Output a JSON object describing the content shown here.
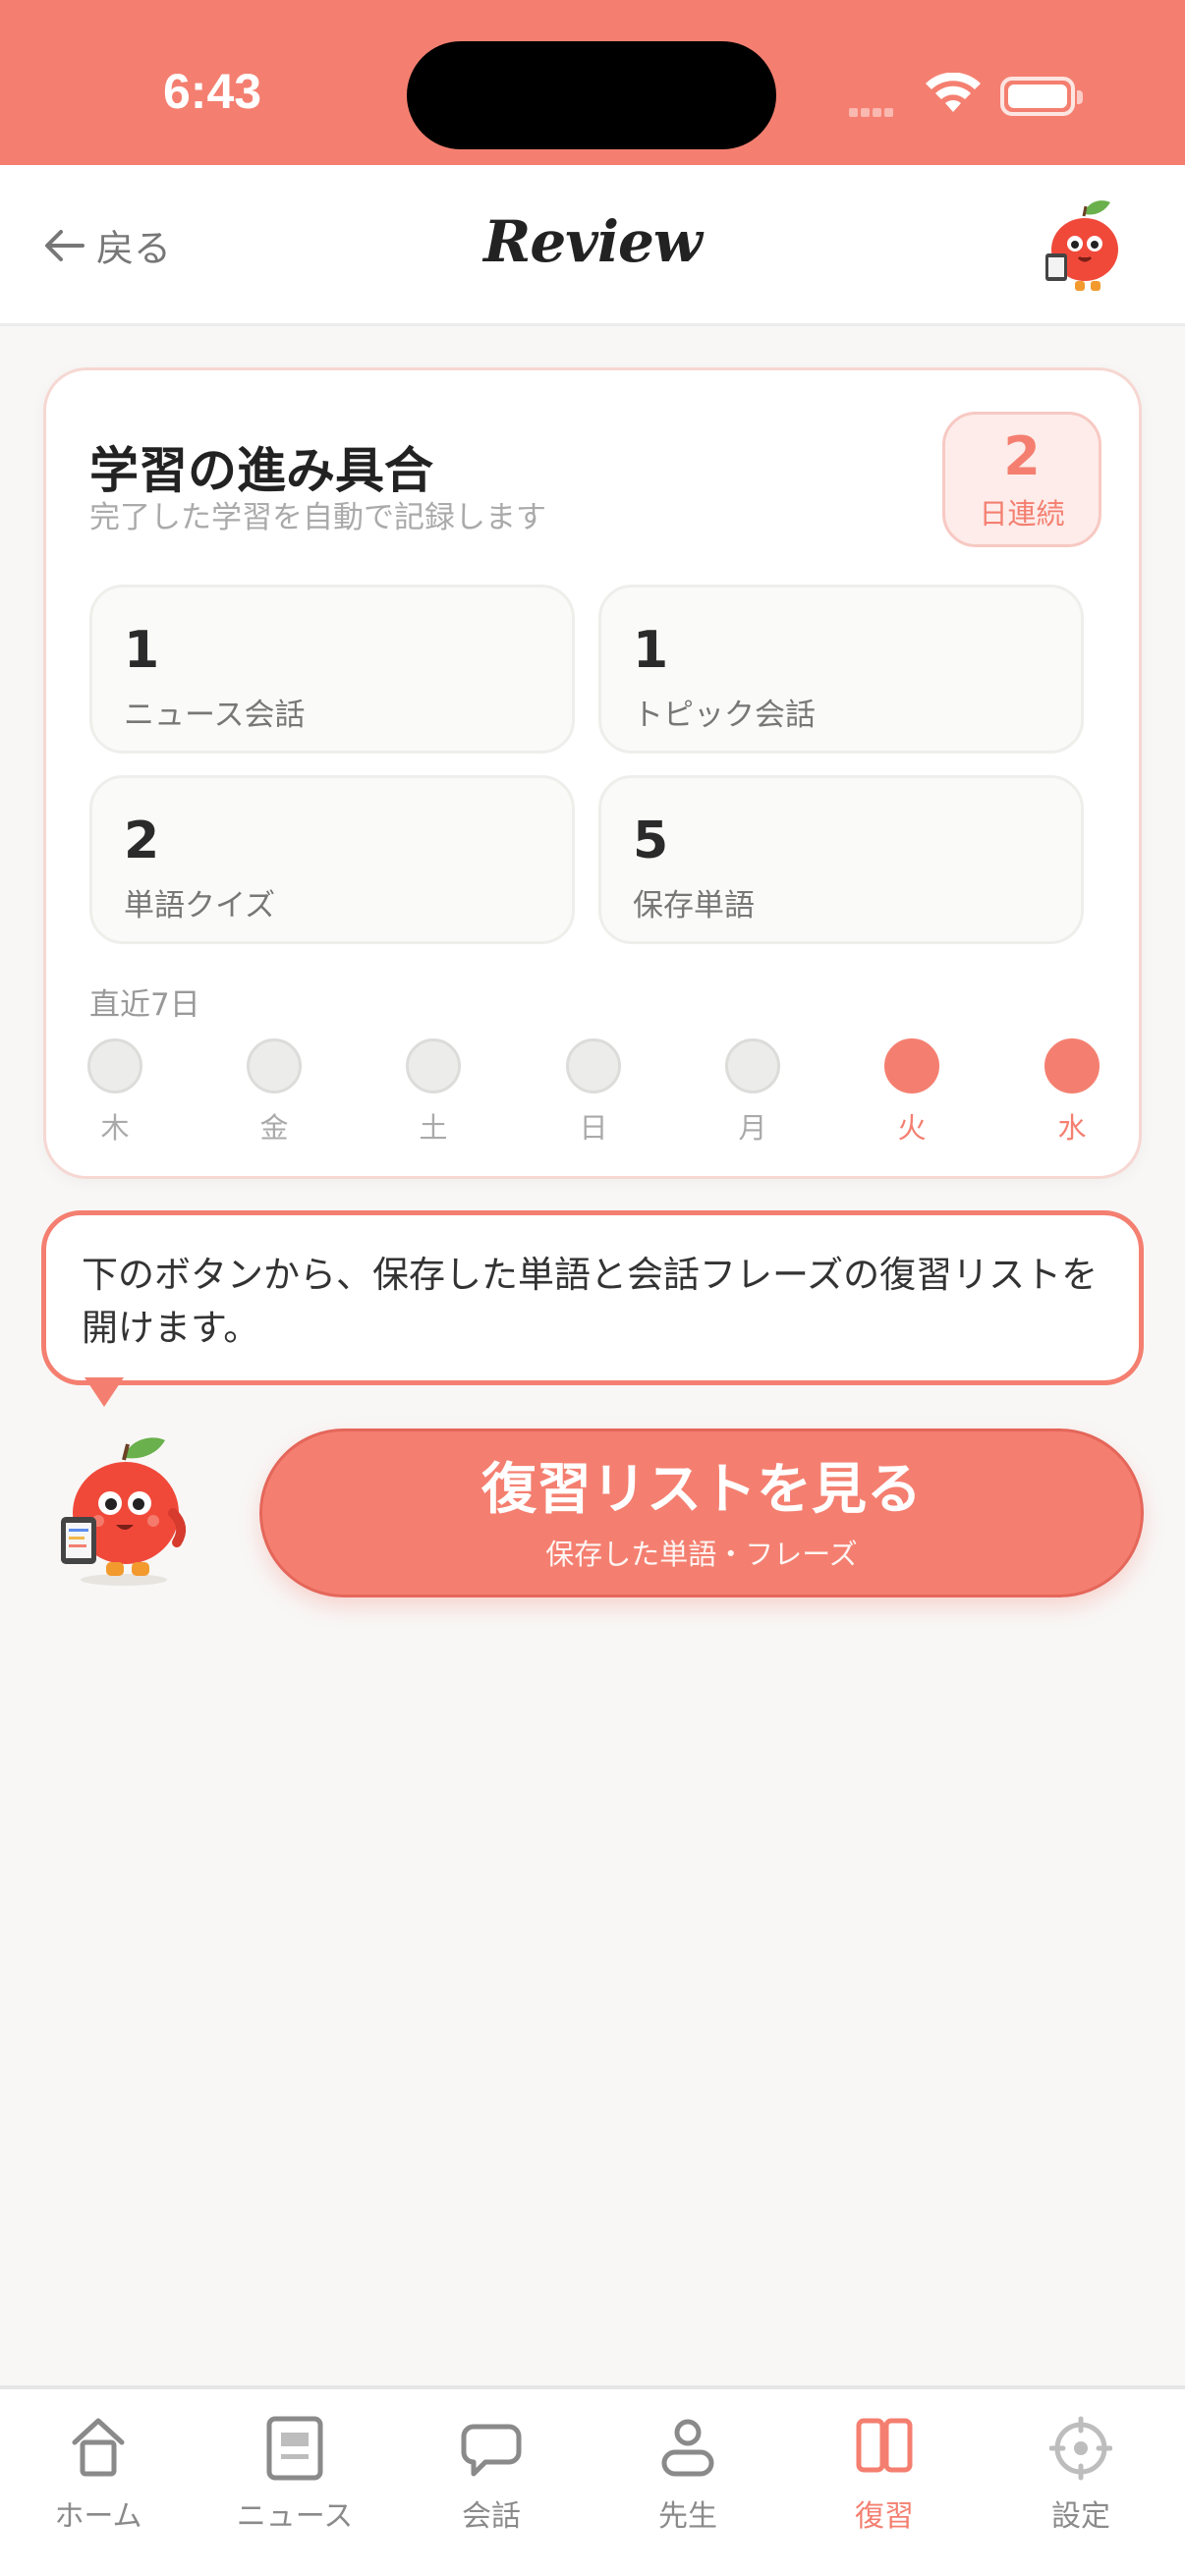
{
  "status_bar": {
    "time": "6:43"
  },
  "nav": {
    "back_label": "戻る",
    "title": "Review"
  },
  "progress": {
    "title": "学習の進み具合",
    "subtitle": "完了した学習を自動で記録します",
    "streak": {
      "value": "2",
      "label": "日連続"
    },
    "stats": [
      {
        "value": "1",
        "label": "ニュース会話"
      },
      {
        "value": "1",
        "label": "トピック会話"
      },
      {
        "value": "2",
        "label": "単語クイズ"
      },
      {
        "value": "5",
        "label": "保存単語"
      }
    ],
    "recent_label": "直近7日",
    "days": [
      {
        "label": "木",
        "done": false
      },
      {
        "label": "金",
        "done": false
      },
      {
        "label": "土",
        "done": false
      },
      {
        "label": "日",
        "done": false
      },
      {
        "label": "月",
        "done": false
      },
      {
        "label": "火",
        "done": true
      },
      {
        "label": "水",
        "done": true
      }
    ]
  },
  "bubble": {
    "text": "下のボタンから、保存した単語と会話フレーズの復習リストを開けます。"
  },
  "cta": {
    "label": "復習リストを見る",
    "sublabel": "保存した単語・フレーズ"
  },
  "tabs": [
    {
      "label": "ホーム",
      "icon": "home-icon",
      "active": false
    },
    {
      "label": "ニュース",
      "icon": "news-icon",
      "active": false
    },
    {
      "label": "会話",
      "icon": "chat-icon",
      "active": false
    },
    {
      "label": "先生",
      "icon": "teacher-icon",
      "active": false
    },
    {
      "label": "復習",
      "icon": "review-icon",
      "active": true
    },
    {
      "label": "設定",
      "icon": "settings-icon",
      "active": false
    }
  ],
  "colors": {
    "accent": "#f47f70",
    "background": "#f8f7f6"
  }
}
